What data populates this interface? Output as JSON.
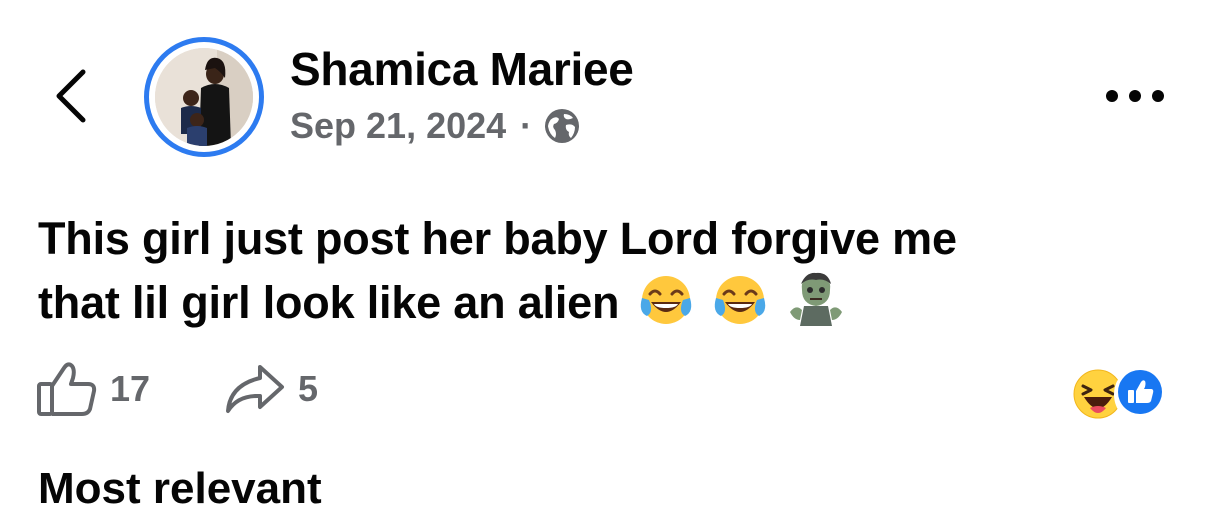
{
  "post": {
    "author": "Shamica Mariee",
    "date": "Sep 21, 2024",
    "separator": "·",
    "audience_icon": "globe-icon",
    "text_line1": "This girl just post her baby Lord forgive me",
    "text_line2": "that lil girl look like an alien",
    "emojis": [
      "tears-of-joy-emoji",
      "tears-of-joy-emoji",
      "zombie-emoji"
    ]
  },
  "actions": {
    "likes": "17",
    "shares": "5"
  },
  "reactions": [
    "haha-reaction-icon",
    "like-reaction-icon"
  ],
  "next_section": {
    "heading": "Most relevant"
  },
  "colors": {
    "accent": "#1877f2",
    "avatar_ring": "#2d7bf0",
    "secondary_text": "#65676b",
    "primary_text": "#050505"
  }
}
